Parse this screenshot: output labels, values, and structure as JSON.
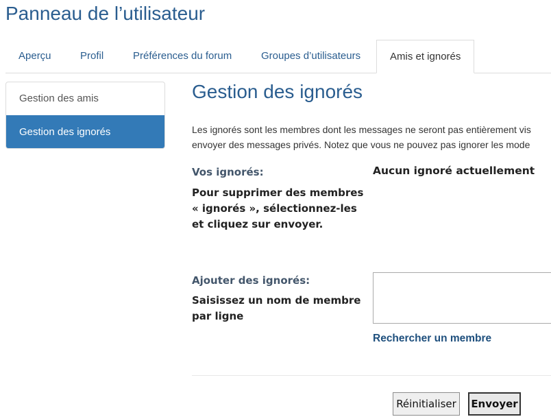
{
  "page": {
    "title": "Panneau de l’utilisateur"
  },
  "tabs": [
    {
      "label": "Aperçu"
    },
    {
      "label": "Profil"
    },
    {
      "label": "Préférences du forum"
    },
    {
      "label": "Groupes d’utilisateurs"
    },
    {
      "label": "Amis et ignorés",
      "active": true
    }
  ],
  "sidebar": {
    "items": [
      {
        "label": "Gestion des amis"
      },
      {
        "label": "Gestion des ignorés",
        "active": true
      }
    ]
  },
  "main": {
    "heading": "Gestion des ignorés",
    "description_line1": "Les ignorés sont les membres dont les messages ne seront pas entièrement vis",
    "description_line2": "envoyer des messages privés. Notez que vous ne pouvez pas ignorer les mode",
    "your_ignored_label": "Vos ignorés:",
    "your_ignored_help": "Pour supprimer des membres « ignorés », sélectionnez-les et cliquez sur envoyer.",
    "your_ignored_value": "Aucun ignoré actuellement",
    "add_ignored_label": "Ajouter des ignorés:",
    "add_ignored_help": "Saisissez un nom de membre par ligne",
    "add_ignored_value": "",
    "find_member_link": "Rechercher un membre",
    "reset_button": "Réinitialiser",
    "submit_button": "Envoyer"
  },
  "colors": {
    "accent": "#337ab7",
    "title": "#2a5d8f",
    "link": "#1e4f7d"
  }
}
